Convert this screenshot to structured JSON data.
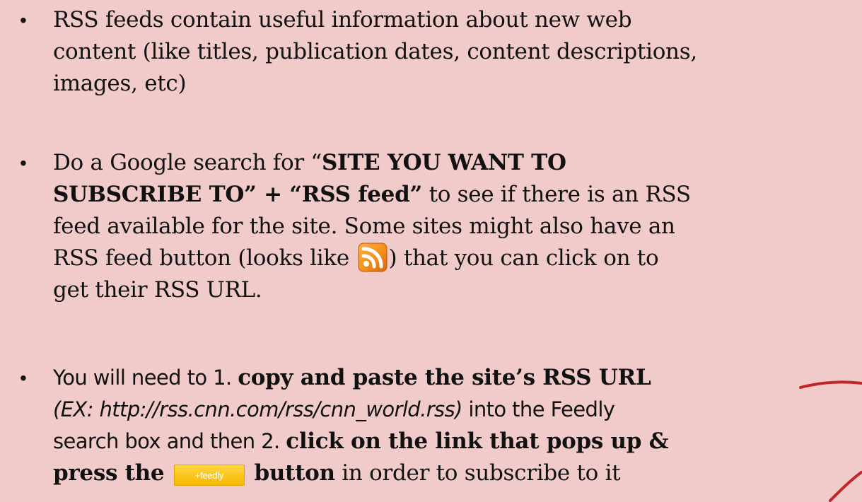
{
  "bullet_char": "•",
  "bullets": [
    {
      "line1": "RSS feeds contain useful information about new web",
      "line2": "content (like titles, publication dates, content descriptions,",
      "line3": "images, etc)"
    },
    {
      "p1": "Do a Google search for “",
      "b1": "SITE YOU WANT TO",
      "b2": "SUBSCRIBE TO” + “RSS feed”",
      "p2": " to see if there is an RSS",
      "p3": "feed available for the site. Some sites might also have an",
      "p4": "RSS feed button (looks like",
      "p5": ") that you can click on to",
      "p6": "get their RSS URL.",
      "icon": "rss-feed-icon"
    },
    {
      "p1": "You will need to 1. ",
      "b1": "copy and paste the site’s RSS URL",
      "i1": "(EX: http://rss.cnn.com/rss/cnn_world.rss)",
      "p2": " into the Feedly",
      "p3": "search box and then 2. ",
      "b2": "click on the link that pops up &",
      "b3": "press the",
      "button_label": "+feedly",
      "b4": "button",
      "p4": " in order to subscribe to it"
    }
  ],
  "colors": {
    "background": "#f0cbc9",
    "text": "#111111",
    "rss_orange": "#f7931e",
    "feedly_yellow": "#f8c21c",
    "ink_red": "#c0262c"
  }
}
